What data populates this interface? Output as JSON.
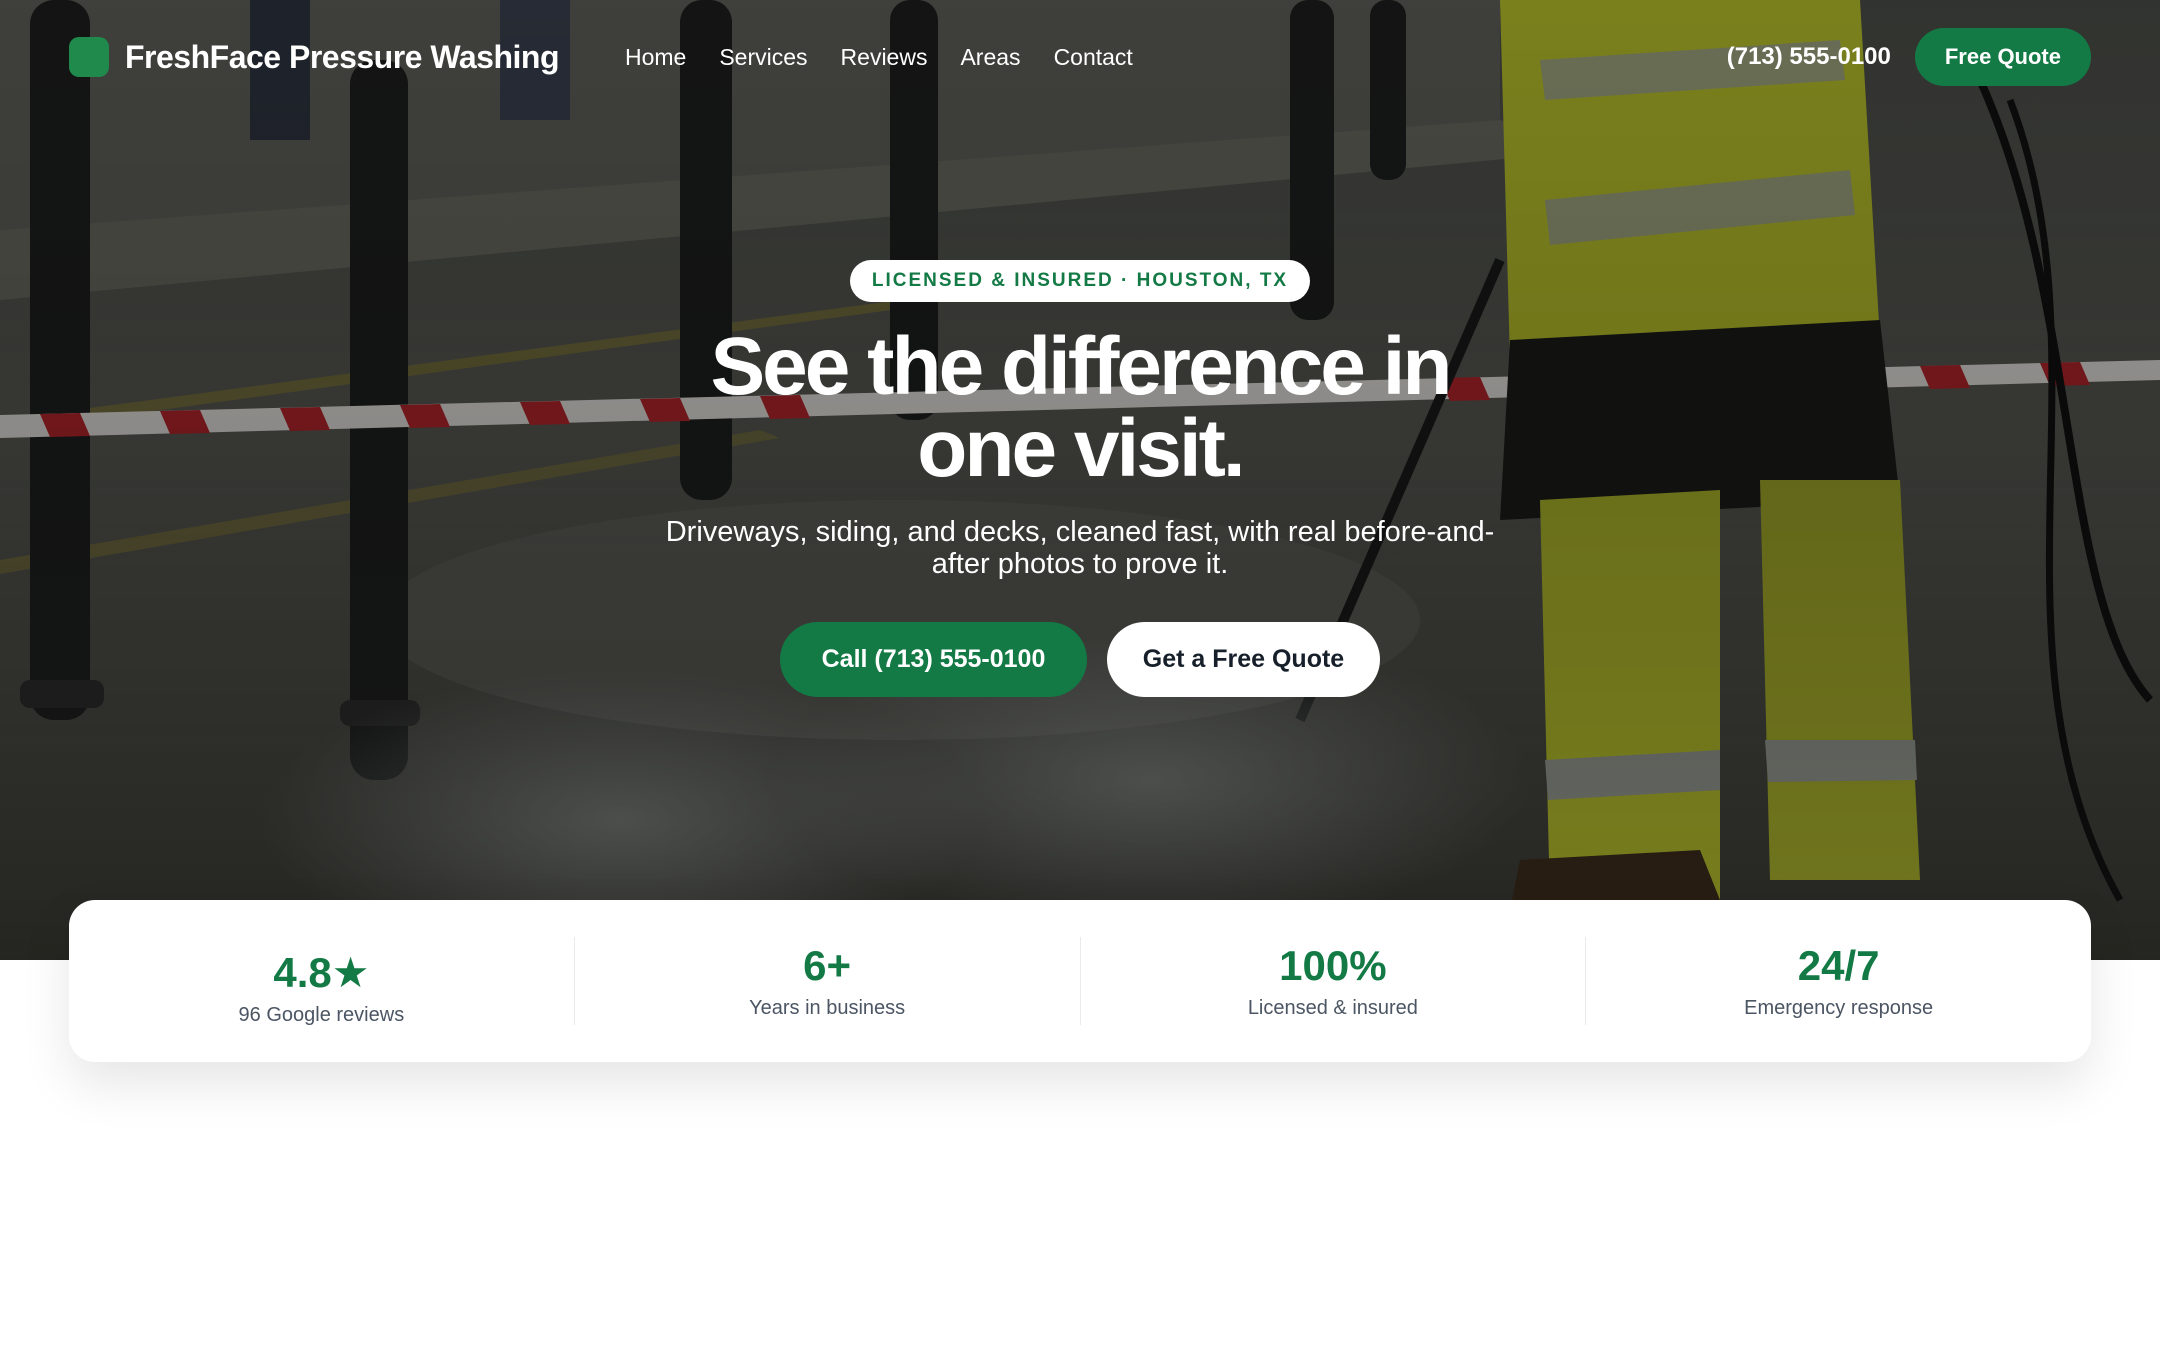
{
  "brand": {
    "name": "FreshFace Pressure Washing",
    "color": "#137a45"
  },
  "nav": {
    "links": [
      "Home",
      "Services",
      "Reviews",
      "Areas",
      "Contact"
    ],
    "phone": "(713) 555-0100",
    "cta": "Free Quote"
  },
  "hero": {
    "badge": "LICENSED & INSURED · HOUSTON, TX",
    "title": "See the difference in one visit.",
    "subtitle": "Driveways, siding, and decks, cleaned fast, with real before-and-after photos to prove it.",
    "primary_button": "Call (713) 555-0100",
    "secondary_button": "Get a Free Quote",
    "background": "worker-pressure-washing-street-photo"
  },
  "stats": [
    {
      "value": "4.8★",
      "label": "96 Google reviews"
    },
    {
      "value": "6+",
      "label": "Years in business"
    },
    {
      "value": "100%",
      "label": "Licensed & insured"
    },
    {
      "value": "24/7",
      "label": "Emergency response"
    }
  ]
}
